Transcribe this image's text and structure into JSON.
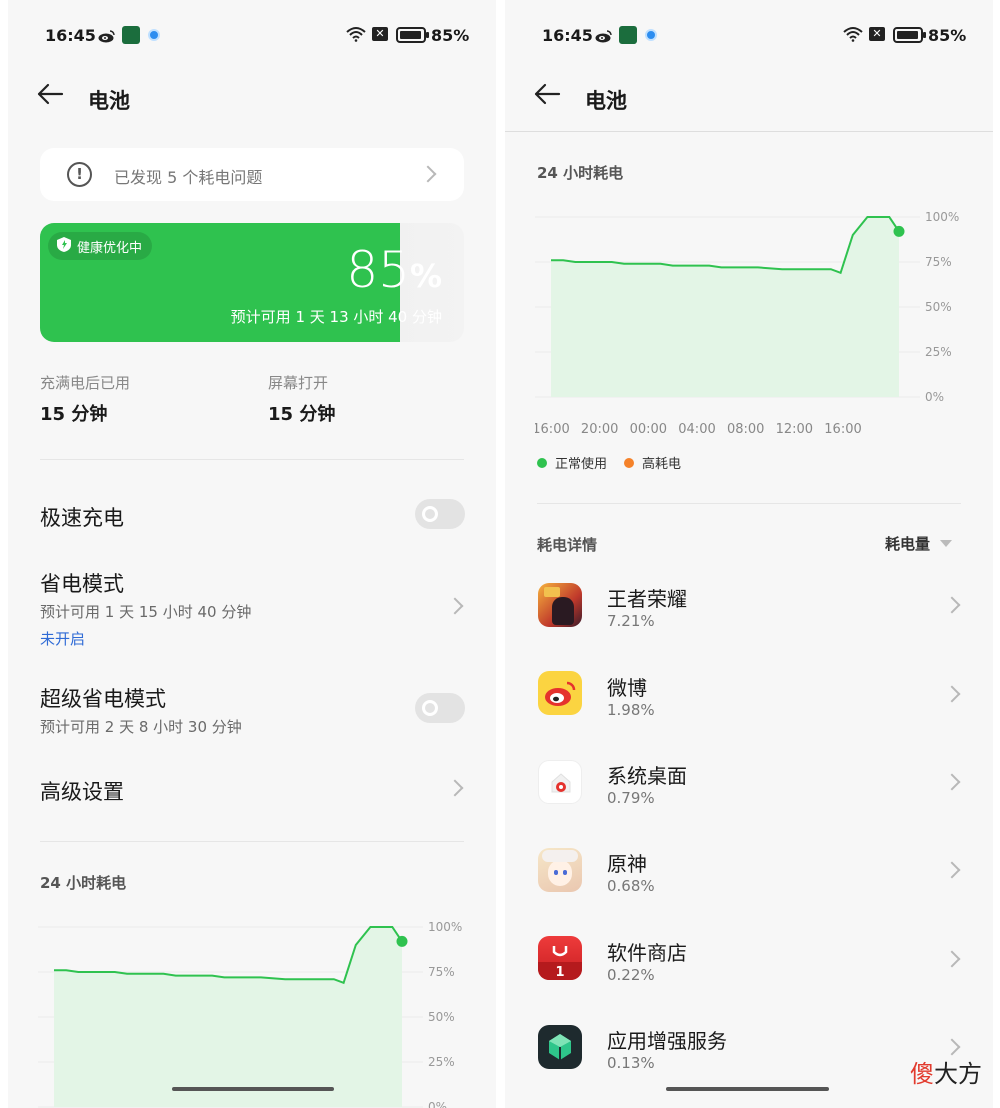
{
  "status": {
    "time": "16:45",
    "battery": "85%"
  },
  "header": {
    "title": "电池"
  },
  "issues": {
    "text": "已发现 5 个耗电问题"
  },
  "battery_card": {
    "badge": "健康优化中",
    "percent_number": "85",
    "percent_sign": "%",
    "level": 0.85,
    "estimate": "预计可用 1 天 13 小时 40 分钟"
  },
  "stats": {
    "since_full_label": "充满电后已用",
    "since_full_value": "15 分钟",
    "screen_on_label": "屏幕打开",
    "screen_on_value": "15 分钟"
  },
  "settings": {
    "fast_charge": "极速充电",
    "power_save": "省电模式",
    "power_save_sub": "预计可用 1 天 15 小时 40 分钟",
    "power_save_state": "未开启",
    "super_save": "超级省电模式",
    "super_save_sub": "预计可用 2 天 8 小时 30 分钟",
    "advanced": "高级设置"
  },
  "usage": {
    "title": "24 小时耗电",
    "legend_normal": "正常使用",
    "legend_high": "高耗电",
    "details_title": "耗电详情",
    "sort_label": "耗电量"
  },
  "colors": {
    "green": "#2fc24f",
    "orange": "#f5822a",
    "link": "#2f6bd6"
  },
  "chart_data": {
    "type": "area",
    "title": "24 小时耗电",
    "x_ticks": [
      "16:00",
      "20:00",
      "00:00",
      "04:00",
      "08:00",
      "12:00",
      "16:00"
    ],
    "y_ticks": [
      "100%",
      "75%",
      "50%",
      "25%",
      "0%"
    ],
    "ylim": [
      0,
      100
    ],
    "series": [
      {
        "name": "正常使用",
        "x_hours": [
          0,
          1,
          2,
          5,
          6,
          9,
          10,
          13,
          14,
          16,
          17,
          19,
          20,
          22,
          23,
          23.8,
          24.8,
          26,
          26.9,
          27.8,
          28.6
        ],
        "values": [
          76,
          76,
          75,
          75,
          74,
          74,
          73,
          73,
          72,
          72,
          72,
          71,
          71,
          71,
          71,
          69,
          90,
          100,
          100,
          100,
          92
        ]
      }
    ],
    "legend": [
      "正常使用",
      "高耗电"
    ],
    "grid": true
  },
  "apps": [
    {
      "name": "王者荣耀",
      "pct": "7.21%",
      "icon": "honor-of-kings-icon"
    },
    {
      "name": "微博",
      "pct": "1.98%",
      "icon": "weibo-icon"
    },
    {
      "name": "系统桌面",
      "pct": "0.79%",
      "icon": "launcher-icon"
    },
    {
      "name": "原神",
      "pct": "0.68%",
      "icon": "genshin-icon"
    },
    {
      "name": "软件商店",
      "pct": "0.22%",
      "icon": "app-store-icon"
    },
    {
      "name": "应用增强服务",
      "pct": "0.13%",
      "icon": "app-enhance-icon"
    }
  ],
  "watermark": "傻大方"
}
